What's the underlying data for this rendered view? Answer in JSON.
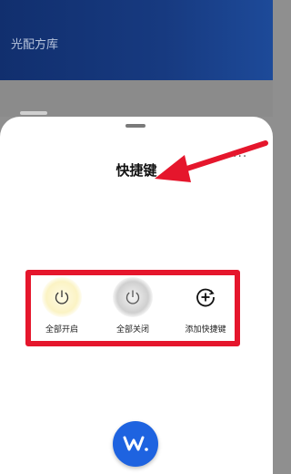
{
  "app": {
    "title": "光配方库"
  },
  "sheet": {
    "title": "快捷键",
    "more_label": "···"
  },
  "actions": [
    {
      "id": "all-on",
      "label": "全部开启",
      "icon": "power-icon"
    },
    {
      "id": "all-off",
      "label": "全部关闭",
      "icon": "power-icon"
    },
    {
      "id": "add-shortcut",
      "label": "添加快捷键",
      "icon": "add-circle-icon"
    }
  ],
  "colors": {
    "header": "#173a80",
    "annotation": "#e5162c",
    "fab": "#1e63e0"
  },
  "fab": {
    "icon": "w-logo-icon",
    "glyph": "W."
  }
}
